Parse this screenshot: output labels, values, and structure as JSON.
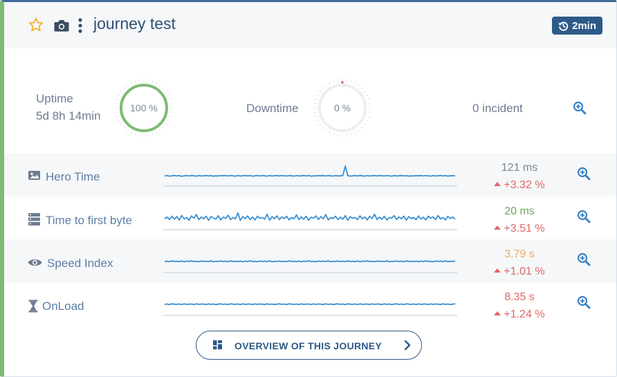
{
  "header": {
    "title": "journey test",
    "refresh_badge": "2min",
    "icons": [
      "star-icon",
      "camera-icon",
      "kebab-menu-icon",
      "history-icon"
    ]
  },
  "summary": {
    "uptime_label": "Uptime",
    "uptime_value": "5d 8h 14min",
    "uptime_percent_text": "100 %",
    "uptime_percent": 100,
    "downtime_label": "Downtime",
    "downtime_percent_text": "0 %",
    "downtime_percent": 0,
    "incident_label": "0 incident"
  },
  "metrics": [
    {
      "label": "Hero Time",
      "icon": "image-icon",
      "value": "121 ms",
      "value_color": "#7b8696",
      "delta": "+3.32 %",
      "spark": [
        0.4,
        0.42,
        0.39,
        0.41,
        0.43,
        0.4,
        0.42,
        0.38,
        0.41,
        0.42,
        0.4,
        0.43,
        0.41,
        0.39,
        0.42,
        0.4,
        0.41,
        0.43,
        0.4,
        0.42,
        0.39,
        0.41,
        0.4,
        0.42,
        0.41,
        0.43,
        0.4,
        0.42,
        0.41,
        0.39,
        0.42,
        0.4,
        0.41,
        0.43,
        0.4,
        0.42,
        0.39,
        0.41,
        0.42,
        0.4,
        0.43,
        0.41,
        0.39,
        0.42,
        0.4,
        0.41,
        0.43,
        0.4,
        0.42,
        0.41,
        0.4,
        0.42,
        0.41,
        0.39,
        0.42,
        0.4,
        0.41,
        0.43,
        0.4,
        0.42,
        0.39,
        0.41,
        0.4,
        0.42,
        0.41,
        0.43,
        0.4,
        0.42,
        0.41,
        0.39,
        0.42,
        0.4,
        0.41,
        0.43,
        1.0,
        0.42,
        0.39,
        0.41,
        0.42,
        0.4,
        0.43,
        0.41,
        0.39,
        0.42,
        0.4,
        0.41,
        0.43,
        0.4,
        0.42,
        0.41,
        0.4,
        0.42,
        0.41,
        0.39,
        0.42,
        0.4,
        0.41,
        0.43,
        0.4,
        0.42,
        0.39,
        0.41,
        0.4,
        0.42,
        0.41,
        0.43,
        0.4,
        0.42,
        0.41,
        0.39,
        0.42,
        0.4,
        0.41,
        0.43,
        0.4,
        0.42,
        0.39,
        0.41,
        0.42,
        0.4
      ]
    },
    {
      "label": "Time to first byte",
      "icon": "server-icon",
      "value": "20 ms",
      "value_color": "#6aaa5e",
      "delta": "+3.51 %",
      "spark": [
        0.45,
        0.55,
        0.4,
        0.6,
        0.42,
        0.58,
        0.38,
        0.65,
        0.44,
        0.52,
        0.36,
        0.62,
        0.48,
        0.7,
        0.4,
        0.55,
        0.45,
        0.6,
        0.35,
        0.58,
        0.5,
        0.42,
        0.63,
        0.38,
        0.55,
        0.47,
        0.66,
        0.4,
        0.52,
        0.44,
        0.8,
        0.35,
        0.58,
        0.46,
        0.62,
        0.4,
        0.55,
        0.38,
        0.6,
        0.48,
        0.52,
        0.42,
        0.72,
        0.36,
        0.58,
        0.44,
        0.62,
        0.4,
        0.55,
        0.46,
        0.6,
        0.38,
        0.52,
        0.45,
        0.68,
        0.4,
        0.56,
        0.42,
        0.6,
        0.36,
        0.55,
        0.48,
        0.62,
        0.4,
        0.58,
        0.44,
        0.7,
        0.38,
        0.52,
        0.46,
        0.6,
        0.4,
        0.55,
        0.42,
        0.64,
        0.36,
        0.58,
        0.48,
        0.52,
        0.4,
        0.62,
        0.44,
        0.56,
        0.38,
        0.6,
        0.46,
        0.72,
        0.4,
        0.55,
        0.42,
        0.6,
        0.38,
        0.52,
        0.48,
        0.64,
        0.4,
        0.56,
        0.44,
        0.6,
        0.36,
        0.58,
        0.46,
        0.52,
        0.4,
        0.62,
        0.42,
        0.55,
        0.38,
        0.6,
        0.48,
        0.56,
        0.4,
        0.64,
        0.44,
        0.52,
        0.38,
        0.6,
        0.46,
        0.55,
        0.42
      ]
    },
    {
      "label": "Speed Index",
      "icon": "eye-icon",
      "value": "3.79 s",
      "value_color": "#f0ab5e",
      "delta": "+1.01 %",
      "spark": [
        0.45,
        0.48,
        0.44,
        0.5,
        0.46,
        0.47,
        0.45,
        0.49,
        0.44,
        0.48,
        0.46,
        0.5,
        0.45,
        0.47,
        0.44,
        0.49,
        0.46,
        0.48,
        0.45,
        0.5,
        0.44,
        0.47,
        0.46,
        0.49,
        0.45,
        0.48,
        0.44,
        0.5,
        0.46,
        0.47,
        0.45,
        0.49,
        0.44,
        0.48,
        0.46,
        0.5,
        0.45,
        0.47,
        0.44,
        0.49,
        0.46,
        0.48,
        0.45,
        0.5,
        0.44,
        0.47,
        0.46,
        0.49,
        0.45,
        0.48,
        0.44,
        0.5,
        0.46,
        0.47,
        0.45,
        0.49,
        0.44,
        0.48,
        0.46,
        0.5,
        0.45,
        0.47,
        0.44,
        0.49,
        0.46,
        0.48,
        0.45,
        0.5,
        0.44,
        0.47,
        0.46,
        0.49,
        0.45,
        0.48,
        0.44,
        0.5,
        0.46,
        0.47,
        0.45,
        0.49,
        0.44,
        0.48,
        0.46,
        0.5,
        0.45,
        0.47,
        0.44,
        0.49,
        0.46,
        0.48,
        0.45,
        0.5,
        0.44,
        0.47,
        0.46,
        0.49,
        0.45,
        0.48,
        0.44,
        0.5,
        0.46,
        0.47,
        0.45,
        0.49,
        0.44,
        0.48,
        0.46,
        0.5,
        0.45,
        0.47,
        0.44,
        0.49,
        0.46,
        0.48,
        0.45,
        0.5,
        0.44,
        0.47,
        0.46,
        0.49
      ]
    },
    {
      "label": "OnLoad",
      "icon": "hourglass-icon",
      "value": "8.35 s",
      "value_color": "#e06767",
      "delta": "+1.24 %",
      "spark": [
        0.46,
        0.48,
        0.45,
        0.49,
        0.47,
        0.46,
        0.48,
        0.45,
        0.49,
        0.46,
        0.47,
        0.48,
        0.45,
        0.49,
        0.46,
        0.48,
        0.47,
        0.45,
        0.49,
        0.46,
        0.48,
        0.45,
        0.47,
        0.49,
        0.46,
        0.48,
        0.45,
        0.49,
        0.47,
        0.46,
        0.48,
        0.45,
        0.49,
        0.46,
        0.47,
        0.48,
        0.45,
        0.49,
        0.46,
        0.48,
        0.47,
        0.45,
        0.49,
        0.46,
        0.48,
        0.45,
        0.47,
        0.49,
        0.46,
        0.48,
        0.45,
        0.49,
        0.47,
        0.46,
        0.48,
        0.45,
        0.49,
        0.46,
        0.47,
        0.48,
        0.45,
        0.49,
        0.46,
        0.48,
        0.47,
        0.45,
        0.49,
        0.46,
        0.48,
        0.45,
        0.47,
        0.49,
        0.46,
        0.48,
        0.45,
        0.49,
        0.47,
        0.46,
        0.48,
        0.45,
        0.49,
        0.46,
        0.47,
        0.48,
        0.45,
        0.49,
        0.46,
        0.48,
        0.47,
        0.45,
        0.49,
        0.46,
        0.48,
        0.45,
        0.47,
        0.49,
        0.46,
        0.48,
        0.45,
        0.49,
        0.47,
        0.46,
        0.48,
        0.45,
        0.49,
        0.46,
        0.47,
        0.48,
        0.45,
        0.49,
        0.46,
        0.48,
        0.47,
        0.45,
        0.49,
        0.46,
        0.48,
        0.45,
        0.47,
        0.49
      ]
    }
  ],
  "overview_button": {
    "label": "OVERVIEW OF THIS JOURNEY",
    "icons": [
      "dashboard-grid-icon",
      "chevron-right-icon"
    ]
  },
  "colors": {
    "brand": "#2d5a87",
    "status_ok": "#7dbb74",
    "sparkline": "#3b8fd1",
    "delta_up": "#e06767",
    "zoom": "#3b82c4"
  }
}
